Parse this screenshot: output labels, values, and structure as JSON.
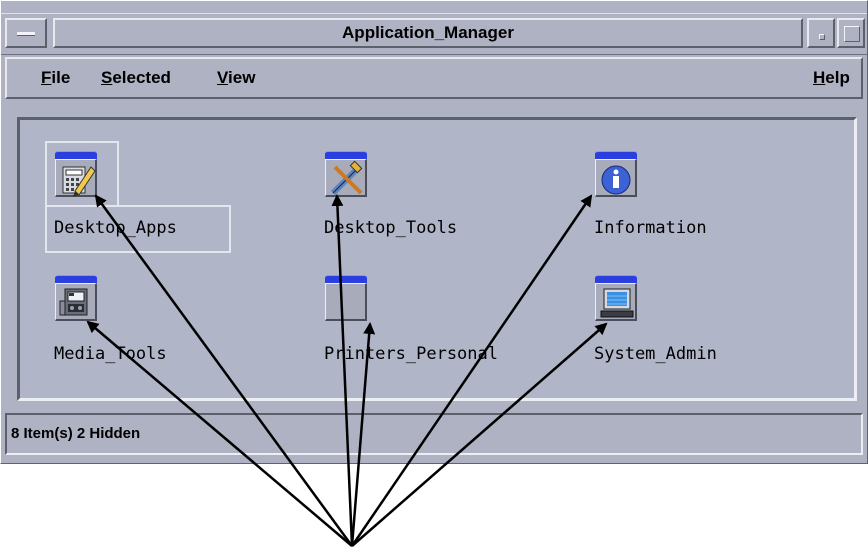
{
  "window": {
    "title": "Application_Manager"
  },
  "menubar": {
    "file": {
      "mnemonic": "F",
      "rest": "ile"
    },
    "selected": {
      "mnemonic": "S",
      "rest": "elected"
    },
    "view": {
      "mnemonic": "V",
      "rest": "iew"
    },
    "help": {
      "mnemonic": "H",
      "rest": "elp"
    }
  },
  "items": [
    {
      "label": "Desktop_Apps",
      "icon": "calculator-pencil-icon",
      "selected": true
    },
    {
      "label": "Desktop_Tools",
      "icon": "tools-icon"
    },
    {
      "label": "Information",
      "icon": "info-icon"
    },
    {
      "label": "Media_Tools",
      "icon": "media-tools-icon"
    },
    {
      "label": "Printers_Personal",
      "icon": "folder-icon"
    },
    {
      "label": "System_Admin",
      "icon": "computer-terminal-icon"
    }
  ],
  "status": {
    "text": "8 Item(s) 2 Hidden"
  },
  "colors": {
    "window_bg": "#aeb2c3",
    "icon_tab": "#2b3fe0",
    "annotation": "#000000"
  }
}
